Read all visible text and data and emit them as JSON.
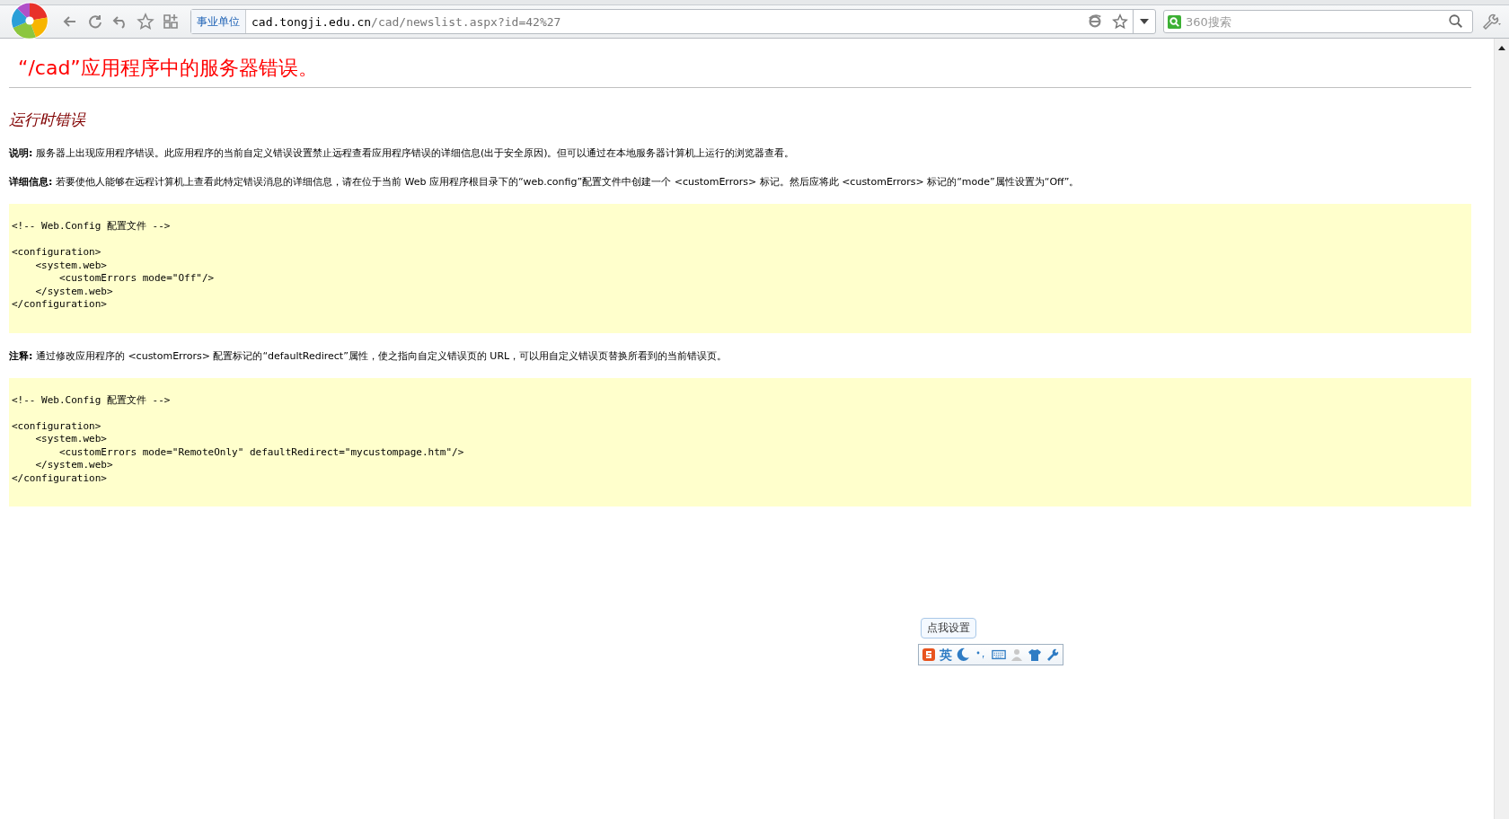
{
  "browser": {
    "address_badge": "事业单位",
    "url_host": "cad.tongji.edu.cn",
    "url_path": "/cad/newslist.aspx?id=42%27",
    "search": {
      "placeholder": "360搜索"
    }
  },
  "page": {
    "title": "“/cad”应用程序中的服务器错误。",
    "subtitle": "运行时错误",
    "blocks": [
      {
        "kind": "paragraph",
        "text": "**说明:** 服务器上出现应用程序错误。此应用程序的当前自定义错误设置禁止远程查看应用程序错误的详细信息(出于安全原因)。但可以通过在本地服务器计算机上运行的浏览器查看。"
      },
      {
        "kind": "paragraph",
        "text": "**详细信息:** 若要使他人能够在远程计算机上查看此特定错误消息的详细信息，请在位于当前 Web 应用程序根目录下的“web.config”配置文件中创建一个 <customErrors> 标记。然后应将此 <customErrors> 标记的“mode”属性设置为“Off”。"
      },
      {
        "kind": "code",
        "text": "<!-- Web.Config 配置文件 -->\n\n<configuration>\n    <system.web>\n        <customErrors mode=\"Off\"/>\n    </system.web>\n</configuration>"
      },
      {
        "kind": "paragraph",
        "text": "**注释:** 通过修改应用程序的 <customErrors> 配置标记的“defaultRedirect”属性，使之指向自定义错误页的 URL，可以用自定义错误页替换所看到的当前错误页。"
      },
      {
        "kind": "code",
        "text": "<!-- Web.Config 配置文件 -->\n\n<configuration>\n    <system.web>\n        <customErrors mode=\"RemoteOnly\" defaultRedirect=\"mycustompage.htm\"/>\n    </system.web>\n</configuration>"
      }
    ]
  },
  "ime": {
    "tooltip": "点我设置",
    "mode": "英"
  }
}
